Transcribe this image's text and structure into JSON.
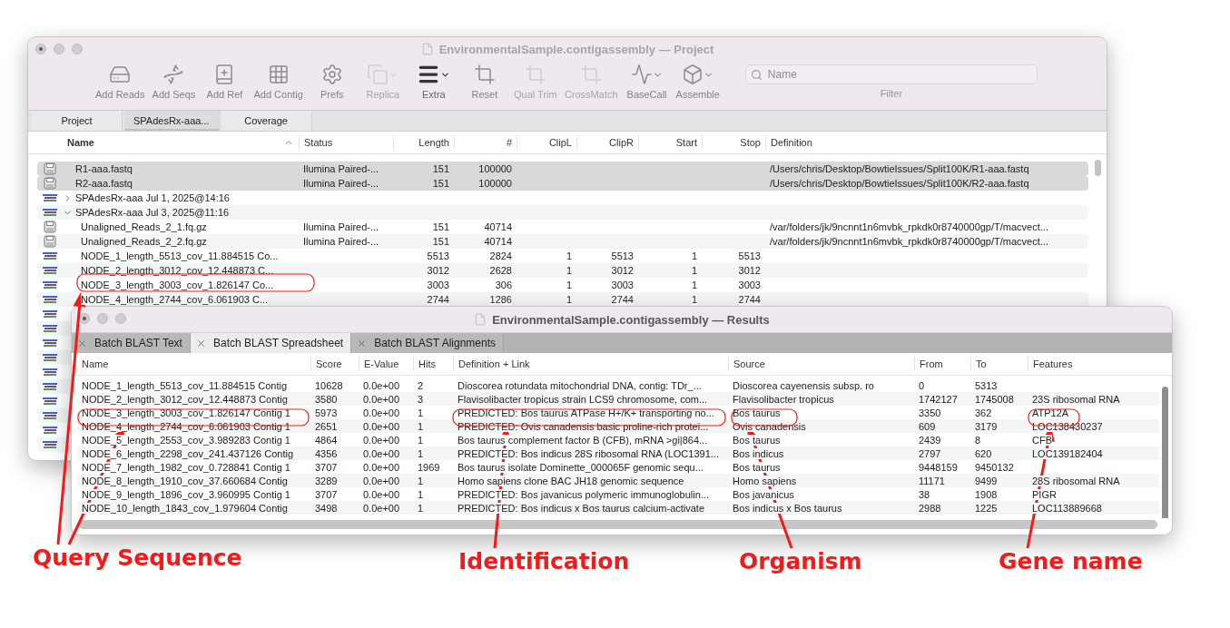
{
  "project_window": {
    "title": "EnvironmentalSample.contigassembly — Project",
    "toolbar": [
      {
        "label": "Add Reads",
        "disabled": false,
        "menu": false
      },
      {
        "label": "Add Seqs",
        "disabled": false,
        "menu": false
      },
      {
        "label": "Add Ref",
        "disabled": false,
        "menu": false
      },
      {
        "label": "Add Contig",
        "disabled": false,
        "menu": false
      },
      {
        "label": "Prefs",
        "disabled": false,
        "menu": false
      },
      {
        "label": "Replica",
        "disabled": true,
        "menu": true
      },
      {
        "label": "Extra",
        "disabled": false,
        "menu": true
      },
      {
        "label": "Reset",
        "disabled": false,
        "menu": false
      },
      {
        "label": "Qual Trim",
        "disabled": true,
        "menu": false
      },
      {
        "label": "CrossMatch",
        "disabled": true,
        "menu": false
      },
      {
        "label": "BaseCall",
        "disabled": false,
        "menu": true
      },
      {
        "label": "Assemble",
        "disabled": false,
        "menu": true
      }
    ],
    "filter": {
      "placeholder": "Name",
      "label": "Filter"
    },
    "tabs": [
      {
        "label": "Project",
        "selected": false
      },
      {
        "label": "SPAdesRx-aaa...",
        "selected": true
      },
      {
        "label": "Coverage",
        "selected": false
      }
    ],
    "columns": [
      {
        "label": "Name",
        "sorted": true
      },
      {
        "label": "Status"
      },
      {
        "label": "Length"
      },
      {
        "label": "#"
      },
      {
        "label": "ClipL"
      },
      {
        "label": "ClipR"
      },
      {
        "label": "Start"
      },
      {
        "label": "Stop"
      },
      {
        "label": "Definition"
      }
    ],
    "rows": [
      {
        "kind": "reads",
        "selected": true,
        "name": "R1-aaa.fastq",
        "status": "Ilumina Paired-...",
        "length": "151",
        "count": "100000",
        "definition": "/Users/chris/Desktop/BowtieIssues/Split100K/R1-aaa.fastq"
      },
      {
        "kind": "reads",
        "selected": true,
        "name": "R2-aaa.fastq",
        "status": "Ilumina Paired-...",
        "length": "151",
        "count": "100000",
        "definition": "/Users/chris/Desktop/BowtieIssues/Split100K/R2-aaa.fastq"
      },
      {
        "kind": "contig",
        "selected": false,
        "expanded": false,
        "name": "SPAdesRx-aaa Jul 1, 2025@14:16"
      },
      {
        "kind": "contig",
        "selected": false,
        "expanded": true,
        "name": "SPAdesRx-aaa Jul 3, 2025@11:16",
        "children": [
          {
            "kind": "reads",
            "selected": false,
            "name": "Unaligned_Reads_2_1.fq.gz",
            "status": "Ilumina Paired-...",
            "length": "151",
            "count": "40714",
            "definition": "/var/folders/jk/9ncnnt1n6mvbk_rpkdk0r8740000gp/T/macvect..."
          },
          {
            "kind": "reads",
            "selected": false,
            "name": "Unaligned_Reads_2_2.fq.gz",
            "status": "Ilumina Paired-...",
            "length": "151",
            "count": "40714",
            "definition": "/var/folders/jk/9ncnnt1n6mvbk_rpkdk0r8740000gp/T/macvect..."
          },
          {
            "kind": "contig",
            "selected": false,
            "name": "NODE_1_length_5513_cov_11.884515 Co...",
            "length": "5513",
            "count": "2824",
            "clip_l": "1",
            "clip_r": "5513",
            "start": "1",
            "stop": "5513"
          },
          {
            "kind": "contig",
            "selected": false,
            "name": "NODE_2_length_3012_cov_12.448873 C...",
            "length": "3012",
            "count": "2628",
            "clip_l": "1",
            "clip_r": "3012",
            "start": "1",
            "stop": "3012"
          },
          {
            "kind": "contig",
            "selected": false,
            "name": "NODE_3_length_3003_cov_1.826147 Co...",
            "length": "3003",
            "count": "306",
            "clip_l": "1",
            "clip_r": "3003",
            "start": "1",
            "stop": "3003"
          },
          {
            "kind": "contig",
            "selected": false,
            "name": "NODE_4_length_2744_cov_6.061903 C...",
            "length": "2744",
            "count": "1286",
            "clip_l": "1",
            "clip_r": "2744",
            "start": "1",
            "stop": "2744"
          },
          {
            "kind": "contig",
            "selected": false
          },
          {
            "kind": "contig",
            "selected": false
          },
          {
            "kind": "contig",
            "selected": false
          },
          {
            "kind": "contig",
            "selected": false
          },
          {
            "kind": "contig",
            "selected": false
          },
          {
            "kind": "contig",
            "selected": false
          },
          {
            "kind": "contig",
            "selected": false
          },
          {
            "kind": "contig",
            "selected": false
          },
          {
            "kind": "contig",
            "selected": false
          },
          {
            "kind": "contig",
            "selected": false
          }
        ]
      }
    ]
  },
  "results_window": {
    "title": "EnvironmentalSample.contigassembly — Results",
    "tabs": [
      {
        "label": "Batch BLAST Text",
        "selected": false
      },
      {
        "label": "Batch BLAST Spreadsheet",
        "selected": true
      },
      {
        "label": "Batch BLAST Alignments",
        "selected": false
      }
    ],
    "columns": [
      "Name",
      "Score",
      "E-Value",
      "Hits",
      "Definition + Link",
      "Source",
      "From",
      "To",
      "Features"
    ],
    "rows": [
      {
        "name": "NODE_1_length_5513_cov_11.884515 Contig",
        "score": "10628",
        "e_value": "0.0e+00",
        "hits": "2",
        "definition": "Dioscorea rotundata mitochondrial DNA, contig: TDr_...",
        "source": "Dioscorea cayenensis subsp. ro",
        "from": "0",
        "to": "5313"
      },
      {
        "name": "NODE_2_length_3012_cov_12.448873 Contig",
        "score": "3580",
        "e_value": "0.0e+00",
        "hits": "3",
        "definition": "Flavisolibacter tropicus strain LCS9 chromosome, com...",
        "source": "Flavisolibacter tropicus",
        "from": "1742127",
        "to": "1745008",
        "features": "23S ribosomal RNA"
      },
      {
        "name": "NODE_3_length_3003_cov_1.826147 Contig 1",
        "score": "5973",
        "e_value": "0.0e+00",
        "hits": "1",
        "definition": "PREDICTED: Bos taurus ATPase H+/K+ transporting no...",
        "source": "Bos taurus",
        "from": "3350",
        "to": "362",
        "features": "ATP12A"
      },
      {
        "name": "NODE_4_length_2744_cov_6.061903 Contig 1",
        "score": "2651",
        "e_value": "0.0e+00",
        "hits": "1",
        "definition": "PREDICTED: Ovis canadensis basic proline-rich protei...",
        "source": "Ovis canadensis",
        "from": "609",
        "to": "3179",
        "features": "LOC138430237"
      },
      {
        "name": "NODE_5_length_2553_cov_3.989283 Contig 1",
        "score": "4864",
        "e_value": "0.0e+00",
        "hits": "1",
        "definition": "Bos taurus complement factor B (CFB), mRNA >gi|864...",
        "source": "Bos taurus",
        "from": "2439",
        "to": "8",
        "features": "CFB"
      },
      {
        "name": "NODE_6_length_2298_cov_241.437126 Contig",
        "score": "4356",
        "e_value": "0.0e+00",
        "hits": "1",
        "definition": "PREDICTED: Bos indicus 28S ribosomal RNA (LOC1391...",
        "source": "Bos indicus",
        "from": "2797",
        "to": "620",
        "features": "LOC139182404"
      },
      {
        "name": "NODE_7_length_1982_cov_0.728841 Contig 1",
        "score": "3707",
        "e_value": "0.0e+00",
        "hits": "1969",
        "definition": "Bos taurus isolate Dominette_000065F genomic sequ...",
        "source": "Bos taurus",
        "from": "9448159",
        "to": "9450132"
      },
      {
        "name": "NODE_8_length_1910_cov_37.660684 Contig",
        "score": "3289",
        "e_value": "0.0e+00",
        "hits": "1",
        "definition": "Homo sapiens clone BAC JH18 genomic sequence",
        "source": "Homo sapiens",
        "from": "11171",
        "to": "9499",
        "features": "28S ribosomal RNA"
      },
      {
        "name": "NODE_9_length_1896_cov_3.960995 Contig 1",
        "score": "3707",
        "e_value": "0.0e+00",
        "hits": "1",
        "definition": "PREDICTED: Bos javanicus polymeric immunoglobulin...",
        "source": "Bos javanicus",
        "from": "38",
        "to": "1908",
        "features": "PIGR"
      },
      {
        "name": "NODE_10_length_1843_cov_1.979604 Contig",
        "score": "3498",
        "e_value": "0.0e+00",
        "hits": "1",
        "definition": "PREDICTED: Bos indicus x Bos taurus calcium-activate",
        "source": "Bos indicus x Bos taurus",
        "from": "2988",
        "to": "1225",
        "features": "LOC113889668"
      }
    ]
  },
  "annotations": [
    {
      "label": "Query Sequence"
    },
    {
      "label": "Identification"
    },
    {
      "label": "Organism"
    },
    {
      "label": "Gene name"
    }
  ]
}
